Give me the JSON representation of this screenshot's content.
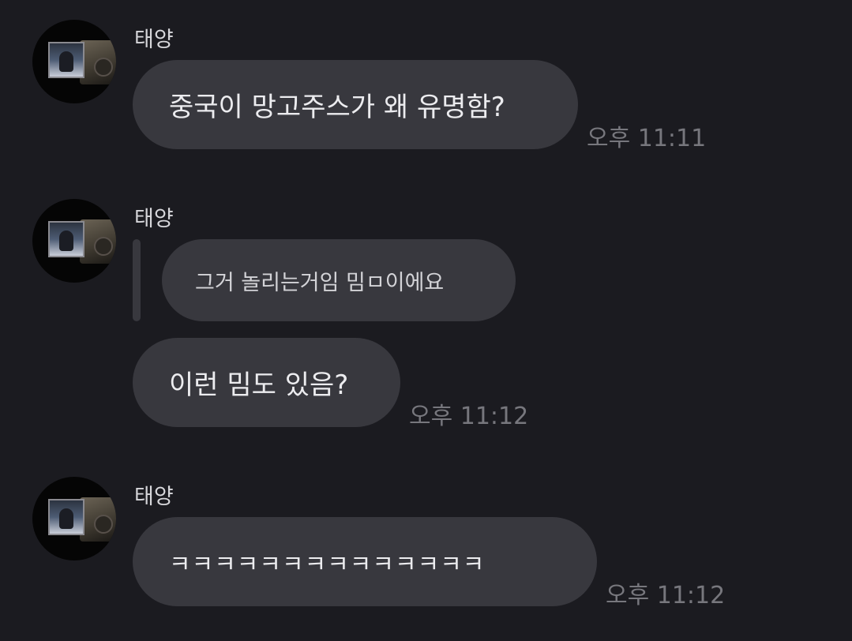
{
  "messages": [
    {
      "sender": "태양",
      "text": "중국이 망고주스가 왜 유명함?",
      "time": "오후 11:11"
    },
    {
      "sender": "태양",
      "reply": "그거 놀리는거임 밈ㅁ이에요",
      "text": "이런 밈도 있음?",
      "time": "오후 11:12"
    },
    {
      "sender": "태양",
      "text": "ㅋㅋㅋㅋㅋㅋㅋㅋㅋㅋㅋㅋㅋㅋ",
      "time": "오후 11:12"
    }
  ],
  "colors": {
    "background": "#1b1b20",
    "bubble": "#38383e",
    "text": "#ececef",
    "time": "#77777d"
  }
}
